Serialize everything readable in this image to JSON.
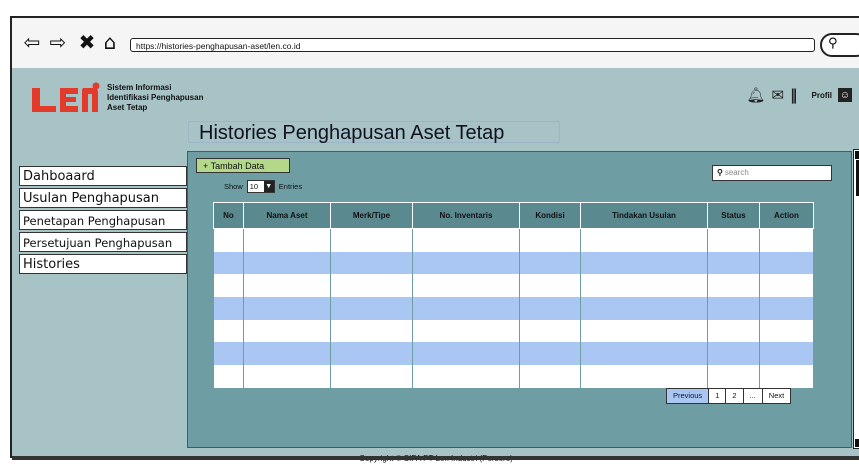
{
  "browser": {
    "url": "https://histories-penghapusan-aset/len.co.id",
    "icons": [
      "back-icon",
      "forward-icon",
      "close-icon",
      "home-icon",
      "search-icon"
    ]
  },
  "header": {
    "brand_lines": [
      "Sistem Informasi",
      "Identifikasi Penghapusan",
      "Aset Tetap"
    ],
    "profile_label": "Profil",
    "icons": [
      "bell-icon",
      "mail-icon",
      "menu-icon",
      "user-icon"
    ]
  },
  "page_title": "Histories Penghapusan Aset Tetap",
  "sidebar": {
    "items": [
      {
        "label": "Dahboaard"
      },
      {
        "label": "Usulan Penghapusan"
      },
      {
        "label": "Penetapan Penghapusan"
      },
      {
        "label": "Persetujuan Penghapusan"
      },
      {
        "label": "Histories"
      }
    ]
  },
  "toolbar": {
    "add_label": "+ Tambah Data",
    "show_label": "Show",
    "entries_value": "10",
    "entries_label": "Entries",
    "search_placeholder": "search"
  },
  "table": {
    "columns": [
      "No",
      "Nama Aset",
      "Merk/Tipe",
      "No. Inventaris",
      "Kondisi",
      "Tindakan Usulan",
      "Status",
      "Action"
    ],
    "row_count": 7
  },
  "pagination": {
    "previous_label": "Previous",
    "pages": [
      "1",
      "2",
      "..."
    ],
    "next_label": "Next"
  },
  "footer": {
    "copyright": "Copyright ©  SIPA PT Len Industri (Persero)"
  },
  "colors": {
    "app_bg": "#a7c3c6",
    "panel_bg": "#6e9ea3",
    "row_alt": "#a9c7f2",
    "add_button": "#b3d88a",
    "brand_red": "#e23a2b"
  }
}
